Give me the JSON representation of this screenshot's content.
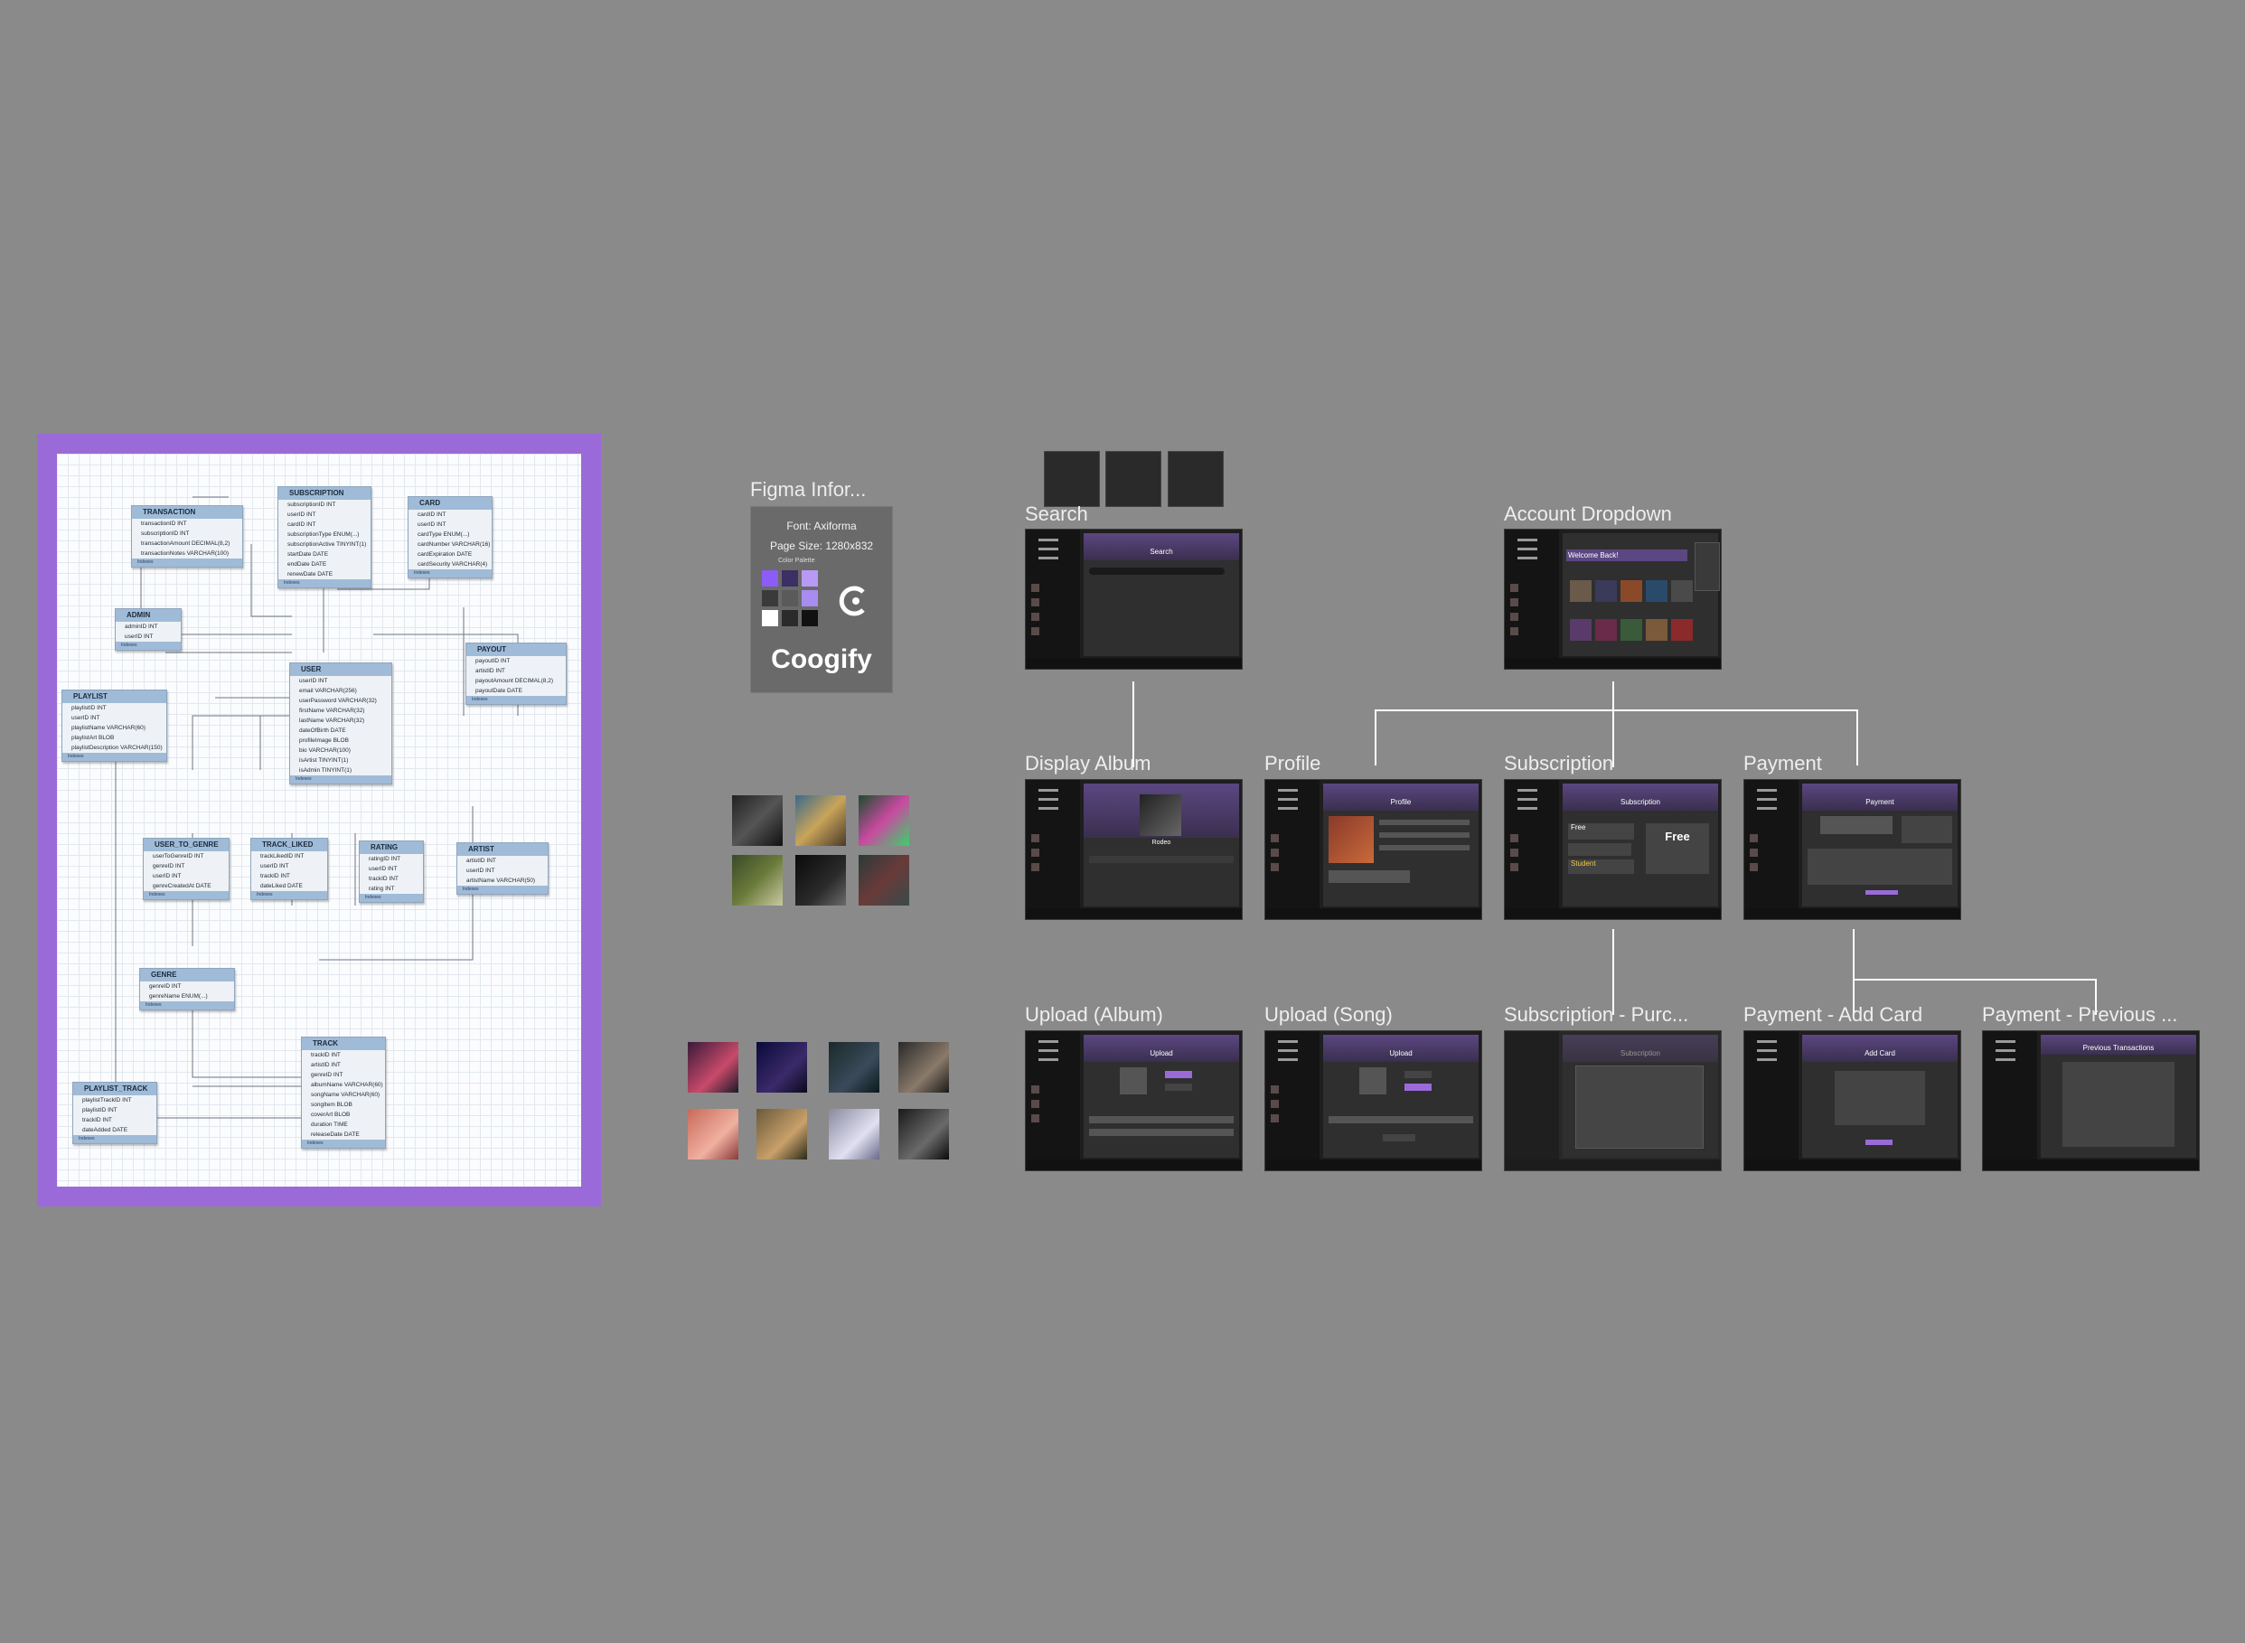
{
  "erd": {
    "tables": {
      "transaction": {
        "name": "TRANSACTION",
        "columns": [
          "transactionID INT",
          "subscriptionID INT",
          "transactionAmount DECIMAL(8,2)",
          "transactionNotes VARCHAR(100)"
        ],
        "footer": "Indexes"
      },
      "subscription": {
        "name": "SUBSCRIPTION",
        "columns": [
          "subscriptionID INT",
          "userID INT",
          "cardID INT",
          "subscriptionType ENUM(...)",
          "subscriptionActive TINYINT(1)",
          "startDate DATE",
          "endDate DATE",
          "renewDate DATE"
        ],
        "footer": "Indexes"
      },
      "card": {
        "name": "CARD",
        "columns": [
          "cardID INT",
          "userID INT",
          "cardType ENUM(...)",
          "cardNumber VARCHAR(16)",
          "cardExpiration DATE",
          "cardSecurity VARCHAR(4)"
        ],
        "footer": "Indexes"
      },
      "admin": {
        "name": "ADMIN",
        "columns": [
          "adminID INT",
          "userID INT"
        ],
        "footer": "Indexes"
      },
      "user": {
        "name": "USER",
        "columns": [
          "userID INT",
          "email VARCHAR(256)",
          "userPassword VARCHAR(32)",
          "firstName VARCHAR(32)",
          "lastName VARCHAR(32)",
          "dateOfBirth DATE",
          "profileImage BLOB",
          "bio VARCHAR(100)",
          "isArtist TINYINT(1)",
          "isAdmin TINYINT(1)"
        ],
        "footer": "Indexes"
      },
      "payout": {
        "name": "PAYOUT",
        "columns": [
          "payoutID INT",
          "artistID INT",
          "payoutAmount DECIMAL(8,2)",
          "payoutDate DATE"
        ],
        "footer": "Indexes"
      },
      "playlist": {
        "name": "PLAYLIST",
        "columns": [
          "playlistID INT",
          "userID INT",
          "playlistName VARCHAR(60)",
          "playlistArt BLOB",
          "playlistDescription VARCHAR(150)"
        ],
        "footer": "Indexes"
      },
      "user_to_genre": {
        "name": "USER_TO_GENRE",
        "columns": [
          "userToGenreID INT",
          "genreID INT",
          "userID INT",
          "genreCreatedAt DATE"
        ],
        "footer": "Indexes"
      },
      "track_liked": {
        "name": "TRACK_LIKED",
        "columns": [
          "trackLikedID INT",
          "userID INT",
          "trackID INT",
          "dateLiked DATE"
        ],
        "footer": "Indexes"
      },
      "rating": {
        "name": "RATING",
        "columns": [
          "ratingID INT",
          "userID INT",
          "trackID INT",
          "rating INT"
        ],
        "footer": "Indexes"
      },
      "artist": {
        "name": "ARTIST",
        "columns": [
          "artistID INT",
          "userID INT",
          "artistName VARCHAR(50)"
        ],
        "footer": "Indexes"
      },
      "genre": {
        "name": "GENRE",
        "columns": [
          "genreID INT",
          "genreName ENUM(...)"
        ],
        "footer": "Indexes"
      },
      "track": {
        "name": "TRACK",
        "columns": [
          "trackID INT",
          "artistID INT",
          "genreID INT",
          "albumName VARCHAR(60)",
          "songName VARCHAR(60)",
          "songItem BLOB",
          "coverArt BLOB",
          "duration TIME",
          "releaseDate DATE"
        ],
        "footer": "Indexes"
      },
      "playlist_track": {
        "name": "PLAYLIST_TRACK",
        "columns": [
          "playlistTrackID INT",
          "playlistID INT",
          "trackID INT",
          "dateAdded DATE"
        ],
        "footer": "Indexes"
      }
    }
  },
  "figma_info": {
    "title": "Figma Infor...",
    "font": "Font: Axiforma",
    "page_size": "Page Size: 1280x832",
    "palette_label": "Color Palette",
    "brand": "Coogify",
    "palette": [
      "#8b5cf6",
      "#3b2f63",
      "#b79af5",
      "#3a3a3a",
      "#5a5a5a",
      "#a88cf0",
      "#ffffff",
      "#2b2b2b",
      "#111111"
    ]
  },
  "screens": {
    "search": {
      "label": "Search",
      "header": "Search"
    },
    "account_dropdown": {
      "label": "Account Dropdown",
      "header": "Welcome Back!"
    },
    "display_album": {
      "label": "Display Album",
      "header": "Rodeo"
    },
    "profile": {
      "label": "Profile",
      "header": "Profile"
    },
    "subscription": {
      "label": "Subscription",
      "header": "Subscription",
      "plan_free": "Free",
      "plan_student": "Student",
      "current": "Free"
    },
    "payment": {
      "label": "Payment",
      "header": "Payment"
    },
    "upload_album": {
      "label": "Upload (Album)",
      "header": "Upload"
    },
    "upload_song": {
      "label": "Upload (Song)",
      "header": "Upload"
    },
    "subscription_purchase": {
      "label": "Subscription - Purc...",
      "header": "Subscription"
    },
    "payment_add_card": {
      "label": "Payment - Add Card",
      "header": "Add Card"
    },
    "payment_previous": {
      "label": "Payment - Previous ...",
      "header": "Previous Transactions"
    }
  },
  "colors": {
    "canvas": "#8a8a8a",
    "accent": "#9b6ad9",
    "table_header": "#9fbbd8"
  }
}
